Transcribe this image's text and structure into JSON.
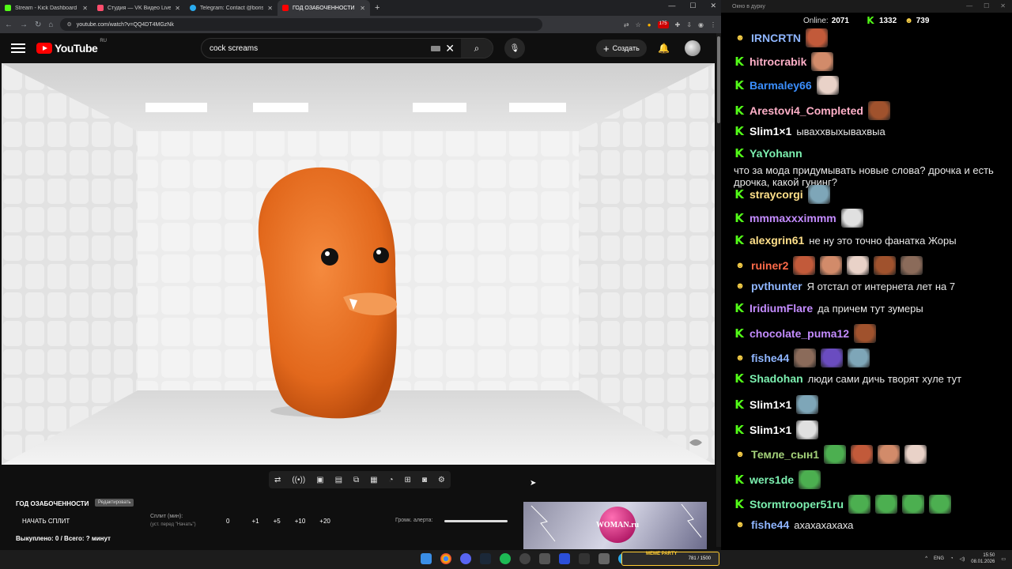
{
  "browser": {
    "tabs": [
      {
        "title": "Stream - Kick Dashboard",
        "color": "#53fc18"
      },
      {
        "title": "Студия — VK Видео Live",
        "color": "#ff4d6d"
      },
      {
        "title": "Telegram: Contact @boris_roch",
        "color": "#2aabee"
      },
      {
        "title": "ГОД ОЗАБОЧЕННОСТИ - Yo",
        "color": "#ff0000"
      }
    ],
    "url": "youtube.com/watch?v=QQ4DT4MGzNk",
    "ext_badge": "175"
  },
  "youtube": {
    "logo_text": "YouTube",
    "region": "RU",
    "search_value": "cock screams",
    "create_label": "Создать"
  },
  "panel": {
    "title": "ГОД ОЗАБОЧЕННОСТИ",
    "edit_label": "Редактировать",
    "start_split": "НАЧАТЬ СПЛИТ",
    "split_label": "Сплит (мин):",
    "split_hint": "(уст. перед \"Начать\")",
    "split_value": "0",
    "steps": [
      "+1",
      "+5",
      "+10",
      "+20"
    ],
    "volume_label": "Громк. алерта:",
    "status": "Выкуплено: 0 / Всего: ? минут",
    "ad_text": "WOMAN.ru"
  },
  "chat": {
    "window_title": "Окно в дурку",
    "online_label": "Online:",
    "online_count": "2071",
    "kick_count": "1332",
    "twitch_count": "739",
    "messages": [
      {
        "user": "IRNCRTN",
        "color": "#8fb6ff",
        "platform": "twitch",
        "text": "",
        "emotes": 1
      },
      {
        "user": "hitrocrabik",
        "color": "#ffb0c8",
        "platform": "kick",
        "text": "",
        "emotes": 1
      },
      {
        "user": "Barmaley66",
        "color": "#3b8fff",
        "platform": "kick",
        "text": "",
        "emotes": 1
      },
      {
        "user": "Arestovi4_Completed",
        "color": "#ffb0c8",
        "platform": "kick",
        "text": "",
        "emotes": 1
      },
      {
        "user": "Slim1×1",
        "color": "#ffffff",
        "platform": "kick",
        "text": "ываххвыхывахвыа",
        "emotes": 0
      },
      {
        "user": "YaYohann",
        "color": "#7cf0b0",
        "platform": "kick",
        "text": "что за мода придумывать новые слова? дрочка и есть дрочка, какой гунинг?",
        "emotes": 0
      },
      {
        "user": "straycorgi",
        "color": "#ffe08a",
        "platform": "kick",
        "text": "",
        "emotes": 1
      },
      {
        "user": "mmmaxxximmm",
        "color": "#c48cff",
        "platform": "kick",
        "text": "",
        "emotes": 1
      },
      {
        "user": "alexgrin61",
        "color": "#ffe08a",
        "platform": "kick",
        "text": "не ну это точно фанатка Жоры",
        "emotes": 0
      },
      {
        "user": "ruiner2",
        "color": "#ff6b4a",
        "platform": "twitch",
        "text": "",
        "emotes": 5
      },
      {
        "user": "pvthunter",
        "color": "#8fb6ff",
        "platform": "twitch",
        "text": "Я отстал от интернета лет на 7",
        "emotes": 0
      },
      {
        "user": "IridiumFlare",
        "color": "#c48cff",
        "platform": "kick",
        "text": "да причем тут зумеры",
        "emotes": 0
      },
      {
        "user": "chocolate_puma12",
        "color": "#c48cff",
        "platform": "kick",
        "text": "",
        "emotes": 1
      },
      {
        "user": "fishe44",
        "color": "#8fb6ff",
        "platform": "twitch",
        "text": "",
        "emotes": 3
      },
      {
        "user": "Shadohan",
        "color": "#7cf0b0",
        "platform": "kick",
        "text": "люди сами дичь творят хуле тут",
        "emotes": 0
      },
      {
        "user": "Slim1×1",
        "color": "#ffffff",
        "platform": "kick",
        "text": "",
        "emotes": 1
      },
      {
        "user": "Slim1×1",
        "color": "#ffffff",
        "platform": "kick",
        "text": "",
        "emotes": 1
      },
      {
        "user": "Темле_сын1",
        "color": "#a4d27a",
        "platform": "twitch",
        "text": "",
        "emotes": 4
      },
      {
        "user": "wers1de",
        "color": "#7cf0b0",
        "platform": "kick",
        "text": "",
        "emotes": 1
      },
      {
        "user": "Stormtrooper51ru",
        "color": "#7cf0b0",
        "platform": "kick",
        "text": "",
        "emotes": 4
      },
      {
        "user": "fishe44",
        "color": "#8fb6ff",
        "platform": "twitch",
        "text": "ахахахахаха",
        "emotes": 0
      }
    ]
  },
  "taskbar": {
    "meme_label": "MEME PARTY",
    "meme_count": "781 / 1500",
    "lang": "ENG",
    "time": "15:50",
    "date": "08.01.2026"
  }
}
